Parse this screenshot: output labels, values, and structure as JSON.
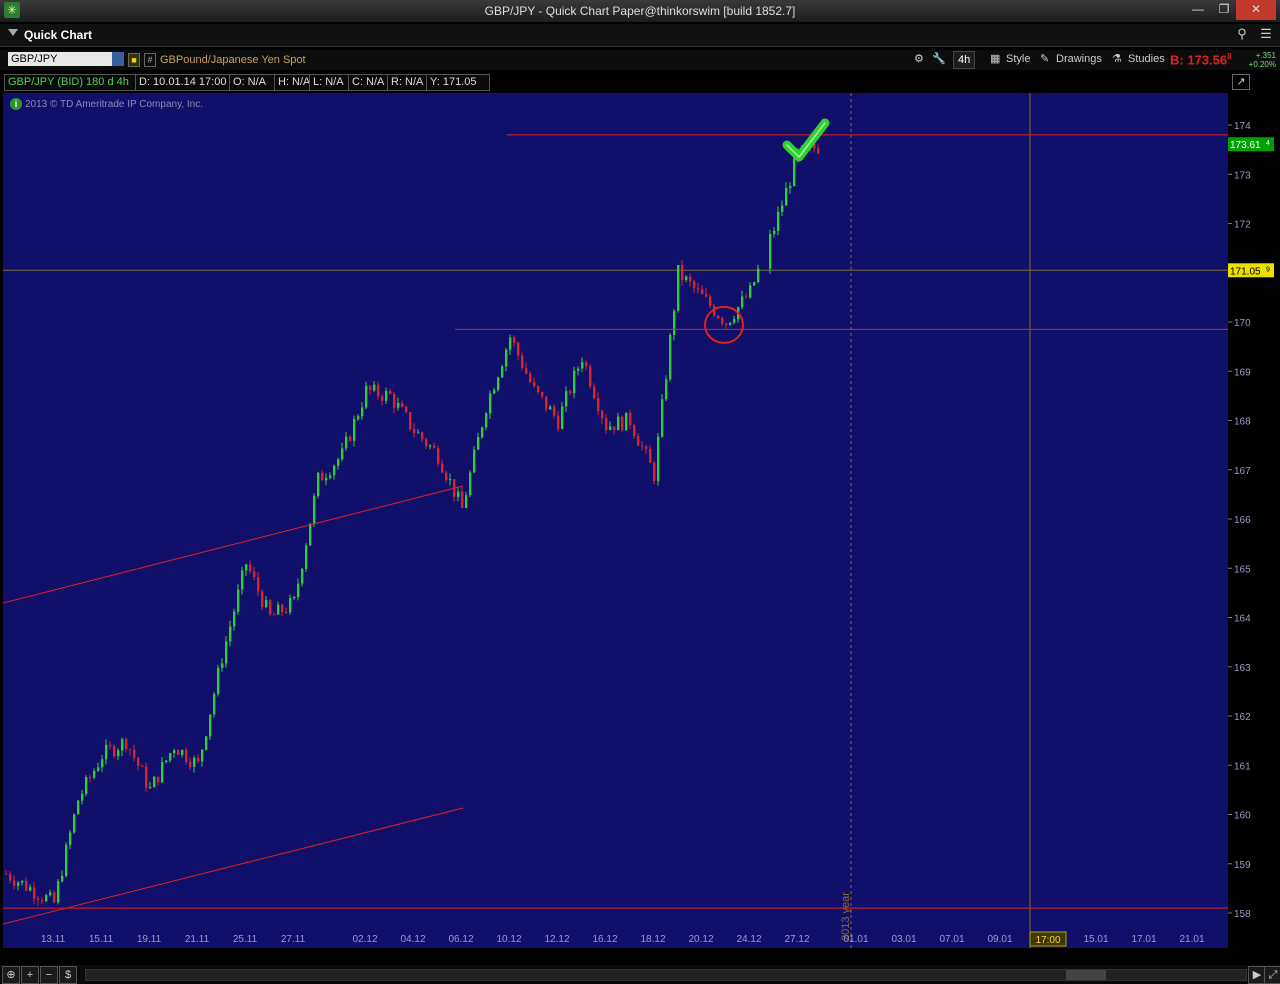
{
  "window": {
    "title": "GBP/JPY - Quick Chart Paper@thinkorswim [build 1852.7]",
    "app_icon": "thinkorswim-icon",
    "buttons": [
      "minimize-icon",
      "maximize-icon",
      "close-icon"
    ]
  },
  "header": {
    "title": "Quick Chart"
  },
  "toolbar": {
    "symbol": "GBP/JPY",
    "description": "GBPound/Japanese Yen Spot",
    "timeframe": "4h",
    "style_label": "Style",
    "drawings_label": "Drawings",
    "studies_label": "Studies",
    "bid": "B: 173.56",
    "bid_suffix": "8",
    "change_abs": "+.351",
    "change_pct": "+0.20%"
  },
  "infobar": {
    "symbol": "GBP/JPY (BID) 180 d 4h",
    "date": "D: 10.01.14 17:00",
    "open": "O: N/A",
    "high": "H: N/A",
    "low": "L: N/A",
    "close": "C: N/A",
    "range": "R: N/A",
    "y": "Y: 171.05"
  },
  "copyright": "2013 © TD Ameritrade IP Company, Inc.",
  "chart_data": {
    "type": "candlestick",
    "background": "#10106a",
    "up_color": "#33cc33",
    "down_color": "#dd2222",
    "ylim": [
      157.8,
      175.0
    ],
    "y_ticks": [
      158,
      159,
      160,
      161,
      162,
      163,
      164,
      165,
      166,
      167,
      168,
      169,
      170,
      171,
      172,
      173,
      174
    ],
    "x_tick_labels": [
      "13.11",
      "15.11",
      "19.11",
      "21.11",
      "25.11",
      "27.11",
      "02.12",
      "04.12",
      "06.12",
      "10.12",
      "12.12",
      "16.12",
      "18.12",
      "20.12",
      "24.12",
      "27.12",
      "01.01",
      "03.01",
      "07.01",
      "09.01",
      "15.01",
      "17.01",
      "21.01"
    ],
    "cursor_time_label": "17:00",
    "year_marker": "2013 year",
    "price_labels": [
      {
        "value": 173.61,
        "text": "173.61",
        "suffix": "4",
        "color": "#00b000"
      },
      {
        "value": 171.05,
        "text": "171.05",
        "suffix": "9",
        "color": "#000000"
      }
    ],
    "horizontal_lines": [
      173.8,
      169.85,
      158.1
    ],
    "annotations": [
      "checkmark",
      "circle"
    ],
    "close_path": [
      {
        "t": "12.11",
        "p": 158.8
      },
      {
        "t": "13.11",
        "p": 158.2
      },
      {
        "t": "14.11",
        "p": 160.3
      },
      {
        "t": "15.11",
        "p": 161.2
      },
      {
        "t": "18.11",
        "p": 161.5
      },
      {
        "t": "19.11",
        "p": 160.5
      },
      {
        "t": "20.11",
        "p": 161.4
      },
      {
        "t": "21.11",
        "p": 161.0
      },
      {
        "t": "22.11",
        "p": 163.2
      },
      {
        "t": "25.11",
        "p": 165.1
      },
      {
        "t": "26.11",
        "p": 164.0
      },
      {
        "t": "27.11",
        "p": 164.3
      },
      {
        "t": "28.11",
        "p": 166.8
      },
      {
        "t": "29.11",
        "p": 167.3
      },
      {
        "t": "02.12",
        "p": 168.6
      },
      {
        "t": "03.12",
        "p": 168.5
      },
      {
        "t": "04.12",
        "p": 167.8
      },
      {
        "t": "05.12",
        "p": 167.3
      },
      {
        "t": "06.12",
        "p": 166.2
      },
      {
        "t": "09.12",
        "p": 168.3
      },
      {
        "t": "10.12",
        "p": 169.7
      },
      {
        "t": "11.12",
        "p": 168.6
      },
      {
        "t": "12.12",
        "p": 168.0
      },
      {
        "t": "13.12",
        "p": 169.3
      },
      {
        "t": "16.12",
        "p": 167.9
      },
      {
        "t": "17.12",
        "p": 168.0
      },
      {
        "t": "18.12",
        "p": 166.9
      },
      {
        "t": "19.12",
        "p": 171.0
      },
      {
        "t": "20.12",
        "p": 170.5
      },
      {
        "t": "23.12",
        "p": 170.0
      },
      {
        "t": "24.12",
        "p": 170.6
      },
      {
        "t": "26.12",
        "p": 171.9
      },
      {
        "t": "27.12",
        "p": 173.4
      },
      {
        "t": "30.12",
        "p": 173.6
      }
    ]
  }
}
